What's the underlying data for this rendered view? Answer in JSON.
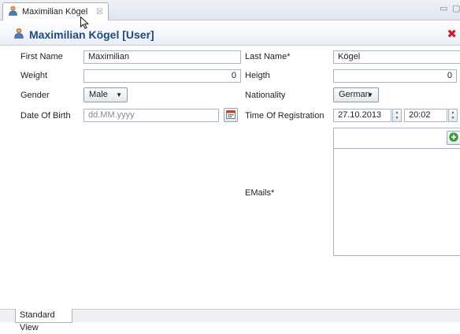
{
  "tab": {
    "title": "Maximilian Kögel",
    "close_glyph": "☒"
  },
  "window_controls": {
    "minimize": "▭",
    "maximize": "▢"
  },
  "header": {
    "title": "Maximilian Kögel [User]",
    "close_glyph": "✖",
    "close_color": "#cc1f1f"
  },
  "form": {
    "first_name": {
      "label": "First Name",
      "value": "Maximilian"
    },
    "last_name": {
      "label": "Last Name*",
      "value": "Kögel"
    },
    "weight": {
      "label": "Weight",
      "value": "0"
    },
    "height": {
      "label": "Heigth",
      "value": "0"
    },
    "gender": {
      "label": "Gender",
      "value": "Male"
    },
    "nationality": {
      "label": "Nationality",
      "value": "German"
    },
    "date_of_birth": {
      "label": "Date Of Birth",
      "placeholder": "dd.MM.yyyy"
    },
    "time_of_registration": {
      "label": "Time Of Registration",
      "date": "27.10.2013",
      "time": "20:02"
    },
    "emails": {
      "label": "EMails*"
    }
  },
  "footer": {
    "tab_label": "Standard View"
  },
  "icons": {
    "user": "user-icon",
    "calendar": "calendar-icon",
    "add": "add-icon",
    "dropdown": "dropdown-arrow-icon",
    "spinner": "spinner-arrows-icon"
  },
  "colors": {
    "header_title": "#1f4a7c",
    "add_green": "#3aa13a"
  }
}
